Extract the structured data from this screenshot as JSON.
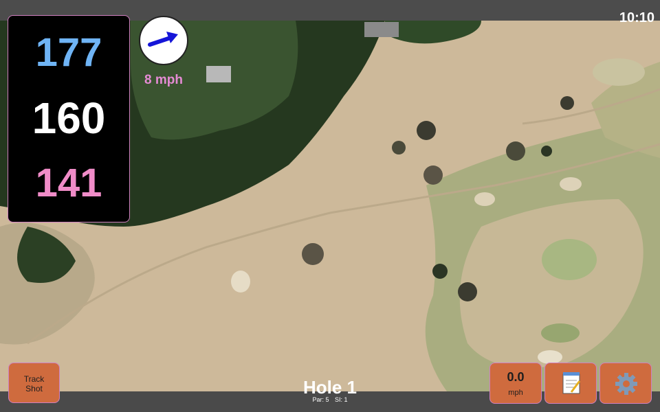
{
  "status": {
    "time": "10:10"
  },
  "distances": {
    "back": "177",
    "middle": "160",
    "front": "141"
  },
  "wind": {
    "speed": "8 mph",
    "icon": "wind-arrow-icon",
    "direction": "east-north-east"
  },
  "hole": {
    "title": "Hole 1",
    "par": "Par: 5",
    "si": "SI: 1"
  },
  "buttons": {
    "track_shot_line1": "Track",
    "track_shot_line2": "Shot",
    "speed_value": "0.0",
    "speed_unit": "mph",
    "notes_icon": "notepad-icon",
    "settings_icon": "gear-icon"
  },
  "colors": {
    "back_distance": "#6fb4f5",
    "middle_distance": "#ffffff",
    "front_distance": "#f08cc8",
    "button": "#cf6b3e",
    "wind_text": "#e58bd4"
  }
}
